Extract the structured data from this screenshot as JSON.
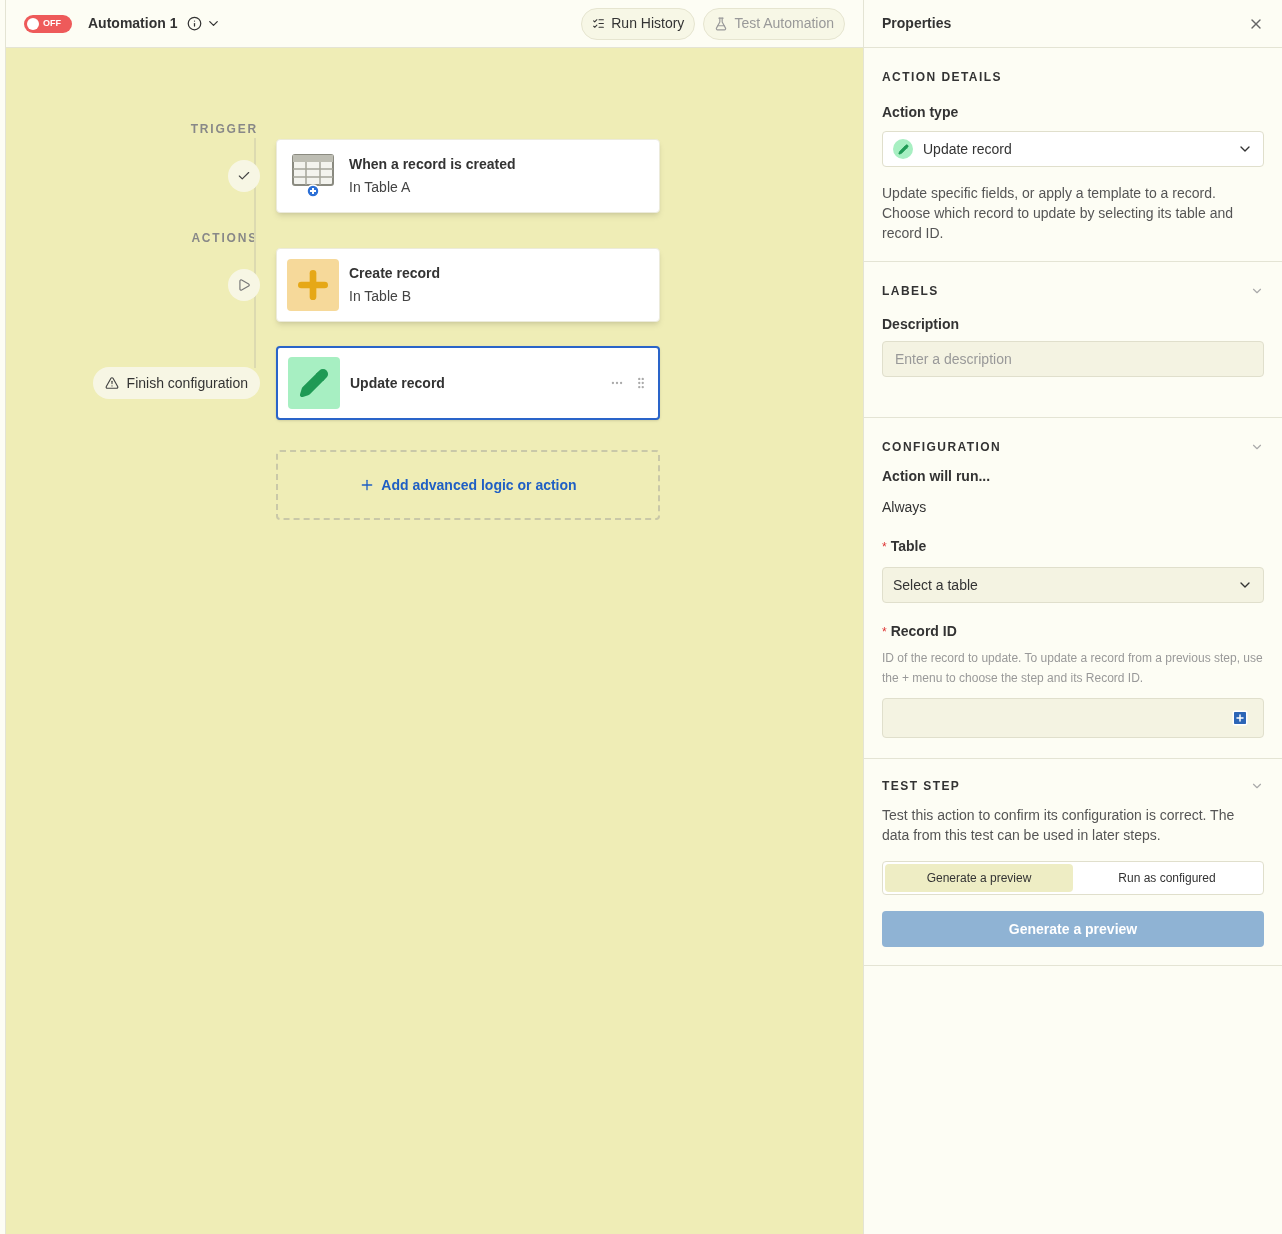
{
  "toolbar": {
    "toggle": {
      "label": "OFF",
      "on": false
    },
    "title": "Automation 1",
    "buttons": [
      {
        "label": "Run History",
        "kind": "history",
        "disabled": false
      },
      {
        "label": "Test Automation",
        "kind": "test",
        "disabled": true
      }
    ]
  },
  "canvas": {
    "sections": [
      {
        "label": "TRIGGER",
        "steps": [
          {
            "title": "When a record is created",
            "subtitle": "In Table A",
            "kind": "table",
            "marker": {
              "kind": "check"
            },
            "selected": false
          }
        ]
      },
      {
        "label": "ACTIONS",
        "steps": [
          {
            "title": "Create record",
            "subtitle": "In Table B",
            "kind": "create",
            "marker": {
              "kind": "play"
            },
            "selected": false
          },
          {
            "title": "Update record",
            "kind": "update",
            "marker": {
              "kind": "warning",
              "label": "Finish configuration"
            },
            "selected": true
          }
        ]
      }
    ],
    "add_button": "Add advanced logic or action"
  },
  "properties": {
    "title": "Properties",
    "action_details": {
      "heading": "ACTION DETAILS",
      "label": "Action type",
      "value": "Update record",
      "description": "Update specific fields, or apply a template to a record. Choose which record to update by selecting its table and record ID."
    },
    "labels": {
      "heading": "LABELS",
      "label": "Description",
      "placeholder": "Enter a description"
    },
    "configuration": {
      "heading": "CONFIGURATION",
      "run_label": "Action will run...",
      "run_value": "Always",
      "table_required_mark": "*",
      "table_label": "Table",
      "table_placeholder": "Select a table",
      "record_required_mark": "*",
      "record_label": "Record ID",
      "record_help": "ID of the record to update. To update a record from a previous step, use the + menu to choose the step and its Record ID."
    },
    "test_step": {
      "heading": "TEST STEP",
      "description": "Test this action to confirm its configuration is correct. The data from this test can be used in later steps.",
      "modes": [
        {
          "label": "Generate a preview",
          "selected": true
        },
        {
          "label": "Run as configured",
          "selected": false
        }
      ],
      "button": "Generate a preview"
    }
  }
}
